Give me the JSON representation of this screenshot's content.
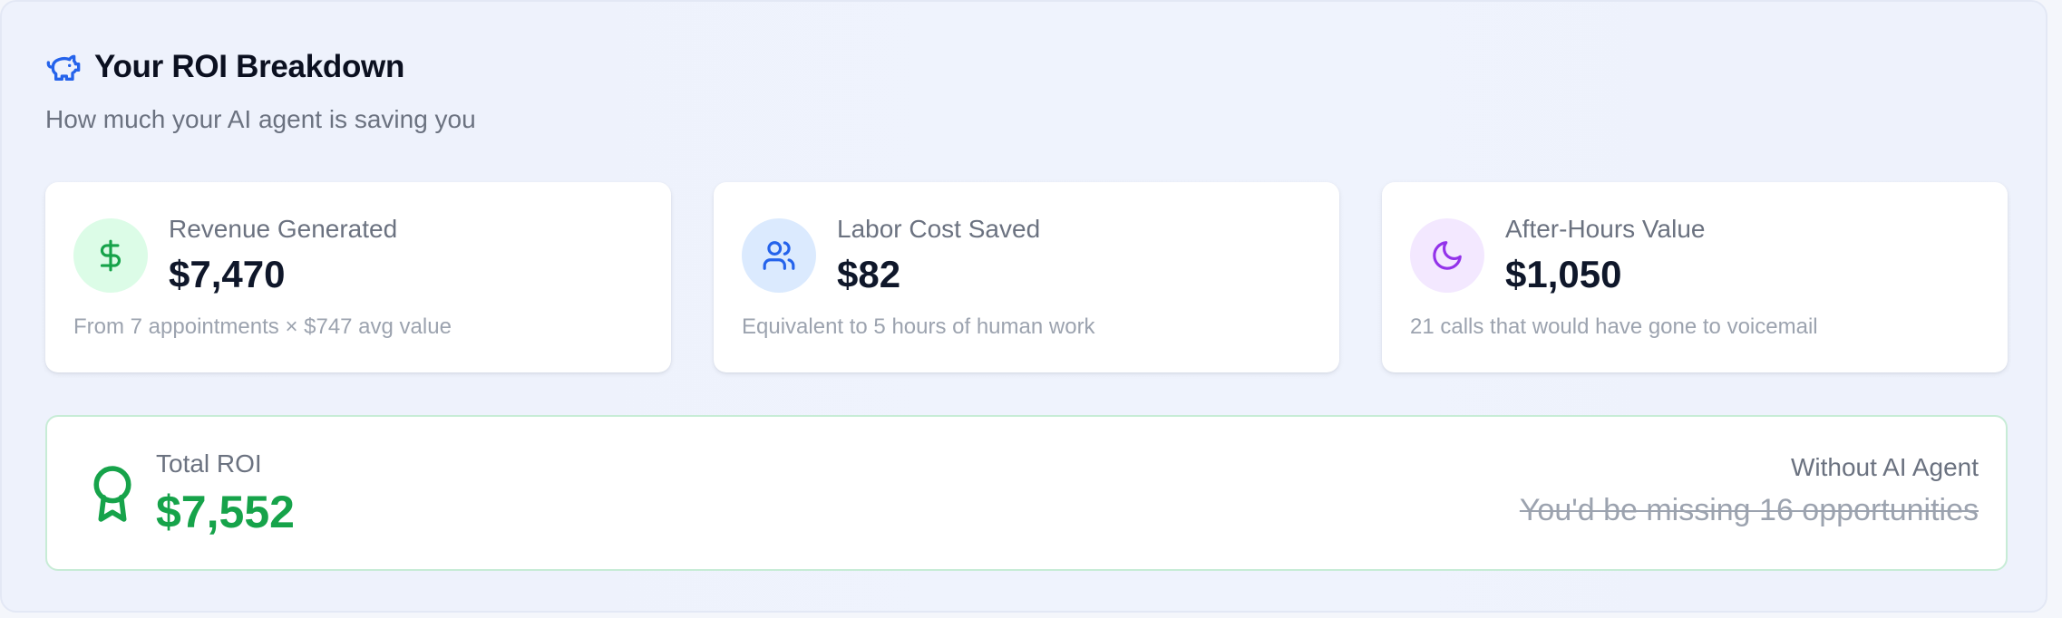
{
  "header": {
    "title": "Your ROI Breakdown",
    "subtitle": "How much your AI agent is saving you",
    "icon": "piggy-bank-icon",
    "icon_color": "#2563eb"
  },
  "cards": [
    {
      "icon": "dollar-icon",
      "icon_color": "#16a34a",
      "icon_bg": "#dcfce7",
      "label": "Revenue Generated",
      "value": "$7,470",
      "note": "From 7 appointments × $747 avg value"
    },
    {
      "icon": "users-icon",
      "icon_color": "#2563eb",
      "icon_bg": "#dbeafe",
      "label": "Labor Cost Saved",
      "value": "$82",
      "note": "Equivalent to 5 hours of human work"
    },
    {
      "icon": "moon-icon",
      "icon_color": "#9333ea",
      "icon_bg": "#f3e8ff",
      "label": "After-Hours Value",
      "value": "$1,050",
      "note": "21 calls that would have gone to voicemail"
    }
  ],
  "total": {
    "icon": "award-icon",
    "icon_color": "#16a34a",
    "label": "Total ROI",
    "value": "$7,552",
    "accent_color": "#16a34a",
    "without_label": "Without AI Agent",
    "without_text": "You'd be missing 16 opportunities"
  }
}
